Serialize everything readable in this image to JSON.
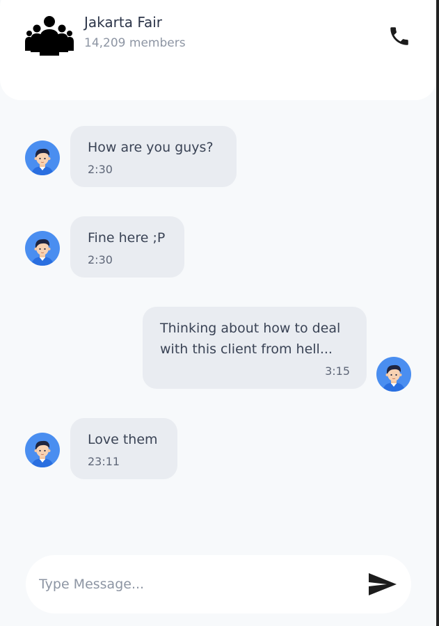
{
  "header": {
    "title": "Jakarta Fair",
    "members": "14,209 members",
    "group_icon": "group-people-icon",
    "call_icon": "phone-icon"
  },
  "messages": [
    {
      "direction": "incoming",
      "text": "How are you guys?",
      "time": "2:30"
    },
    {
      "direction": "incoming",
      "text": "Fine here ;P",
      "time": "2:30"
    },
    {
      "direction": "outgoing",
      "text": "Thinking about how to deal with this client from hell...",
      "time": "3:15"
    },
    {
      "direction": "incoming",
      "text": "Love them",
      "time": "23:11"
    }
  ],
  "composer": {
    "placeholder": "Type Message...",
    "value": "",
    "send_icon": "send-icon"
  },
  "colors": {
    "background": "#f7f9fb",
    "bubble": "#e9ecf1",
    "avatar": "#4a8ef0"
  }
}
